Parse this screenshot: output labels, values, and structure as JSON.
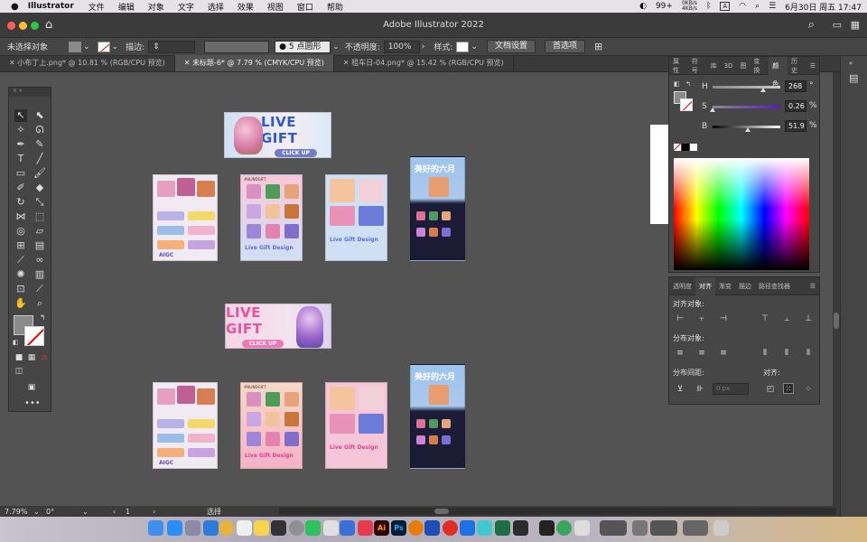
{
  "menubar": {
    "app": "Illustrator",
    "items": [
      "文件",
      "编辑",
      "对象",
      "文字",
      "选择",
      "效果",
      "视图",
      "窗口",
      "帮助"
    ],
    "battery": "99+",
    "net_up": "0KB/s",
    "net_down": "4KB/s",
    "input": "A",
    "datetime": "6月30日 周五  17:47"
  },
  "window": {
    "title": "Adobe Illustrator 2022"
  },
  "control": {
    "no_selection": "未选择对象",
    "stroke_label": "描边:",
    "brush": "5 点圆形",
    "opacity_label": "不透明度:",
    "opacity_value": "100%",
    "style_label": "样式:",
    "doc_setup": "文档设置",
    "prefs": "首选项"
  },
  "tabs": [
    {
      "label": "小布丁上.png* @ 10.81 % (RGB/CPU 预览)"
    },
    {
      "label": "未标题-6* @ 7.79 % (CMYK/CPU 预览)"
    },
    {
      "label": "租车日-04.png* @ 15.42 % (RGB/CPU 预览)"
    }
  ],
  "canvas": {
    "banner1": {
      "title": "LIVE GIFT",
      "button": "CLICK UP"
    },
    "banner2": {
      "title": "LIVE GIFT",
      "button": "CLICK UP"
    },
    "poster_aigc": "AIGC",
    "poster_tag": "#BLINDGIFT",
    "poster_design": "Live Gift Design",
    "poster_june": "美好的六月"
  },
  "color_panel": {
    "tabs": [
      "属性",
      "符号",
      "库",
      "3D",
      "图",
      "变换",
      "颜色",
      "历史"
    ],
    "active_tab": "颜色",
    "h_label": "H",
    "h_value": "268",
    "h_unit": "°",
    "h_level": 0.74,
    "s_label": "S",
    "s_value": "0.26",
    "s_unit": "%",
    "s_level": 0.003,
    "b_label": "B",
    "b_value": "51.9",
    "b_unit": "%",
    "b_level": 0.519
  },
  "align_panel": {
    "tabs": [
      "透明度",
      "对齐",
      "渐变",
      "描边",
      "路径查找器"
    ],
    "active_tab": "对齐",
    "align_objects": "对齐对象:",
    "distribute_objects": "分布对象:",
    "distribute_spacing": "分布间距:",
    "align_to": "对齐:",
    "spacing_value": "0 px"
  },
  "status": {
    "zoom": "7.79%",
    "rotation": "0°",
    "artboard": "1",
    "mode": "选择"
  },
  "colors": {
    "accent": "#2d6fd8",
    "bg": "#535353",
    "panel": "#464646"
  }
}
